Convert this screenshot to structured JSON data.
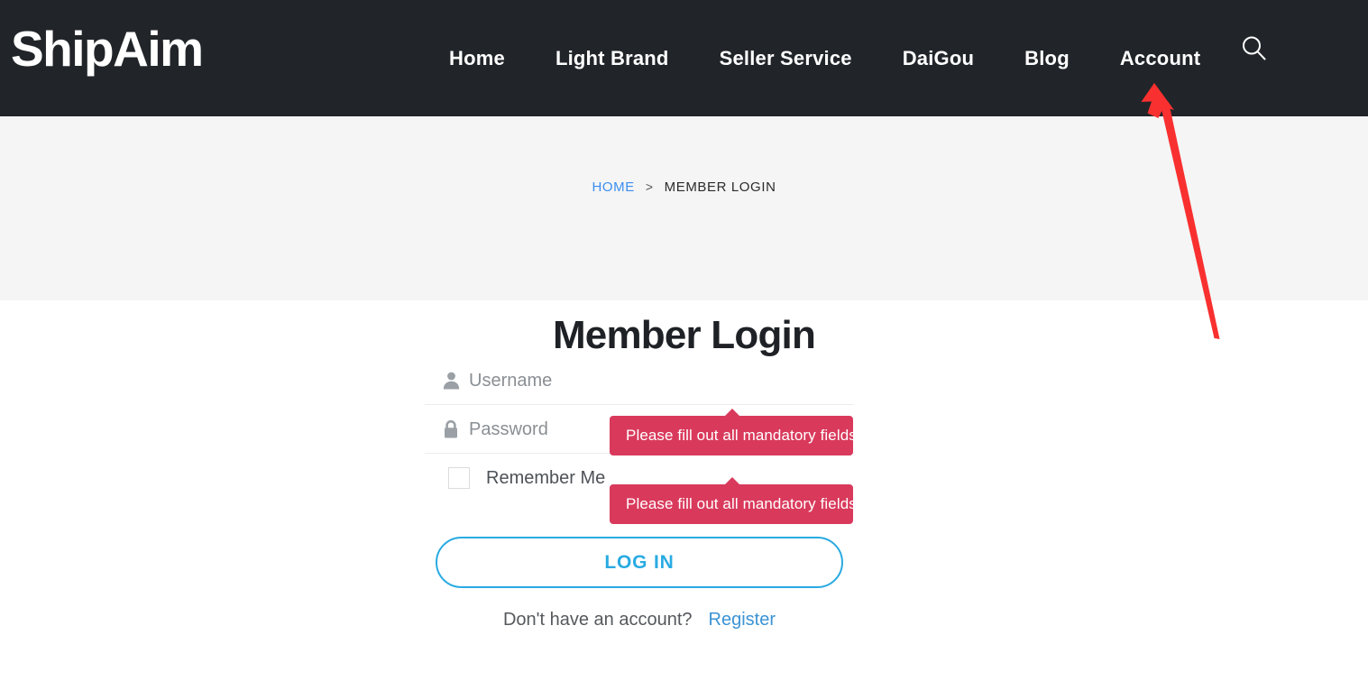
{
  "site": {
    "brand": "ShipAim",
    "brand_color": "#ffffff",
    "header_bg": "#212529",
    "accent_color": "#29ABE2",
    "error_color": "#d93a5c"
  },
  "nav": {
    "items": [
      {
        "label": "Home",
        "name": "nav-home"
      },
      {
        "label": "Light Brand",
        "name": "nav-light-brand"
      },
      {
        "label": "Seller Service",
        "name": "nav-seller-service"
      },
      {
        "label": "DaiGou",
        "name": "nav-daigou"
      },
      {
        "label": "Blog",
        "name": "nav-blog"
      },
      {
        "label": "Account",
        "name": "nav-account"
      }
    ],
    "search_icon": "search-icon"
  },
  "hero": {
    "breadcrumb": {
      "home": "HOME",
      "separator": ">",
      "current": "MEMBER LOGIN"
    },
    "title": "Member Login"
  },
  "form": {
    "username": {
      "placeholder": "Username",
      "value": "",
      "icon": "user-icon"
    },
    "password": {
      "placeholder": "Password",
      "value": "",
      "icon": "lock-icon",
      "toggle_icon": "eye-icon"
    },
    "remember": {
      "label": "Remember Me",
      "checked": false
    },
    "submit_label": "LOG IN",
    "register_prompt": "Don't have an account?",
    "register_label": "Register"
  },
  "tooltips": {
    "password_error": "Please fill out all mandatory fields",
    "remember_error": "Please fill out all mandatory fields"
  },
  "annotation": {
    "arrow_color": "#f93030",
    "points_to": "Account"
  }
}
